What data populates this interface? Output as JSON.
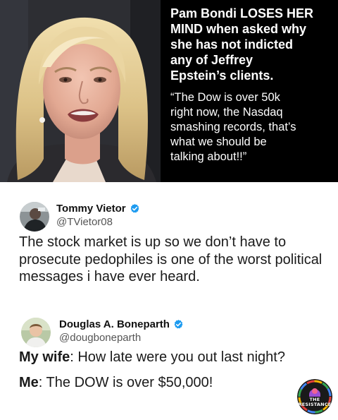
{
  "banner": {
    "headline": "Pam Bondi LOSES HER\nMIND when asked why\nshe has not indicted\nany of Jeffrey\nEpstein’s clients.",
    "quote": "“The Dow is over 50k\nright now, the Nasdaq\nsmashing records, that’s\nwhat we should be\ntalking about!!”"
  },
  "tweets": [
    {
      "name": "Tommy Vietor",
      "handle": "@TVietor08",
      "text": "The stock market is up so we don’t have to prosecute pedophiles is one of the worst political messages i have ever heard.",
      "verified_color": "#1d9bf0"
    },
    {
      "name": "Douglas A. Boneparth",
      "handle": "@dougboneparth",
      "lines": [
        {
          "speaker": "My wife",
          "text": ": How late were you out last night?"
        },
        {
          "speaker": "Me",
          "text": ": The DOW is over $50,000!"
        }
      ],
      "verified_color": "#1d9bf0"
    }
  ],
  "watermark": {
    "line1": "THE",
    "line2": "RESISTANCE"
  },
  "icons": {
    "verified": "verified-badge-icon"
  }
}
